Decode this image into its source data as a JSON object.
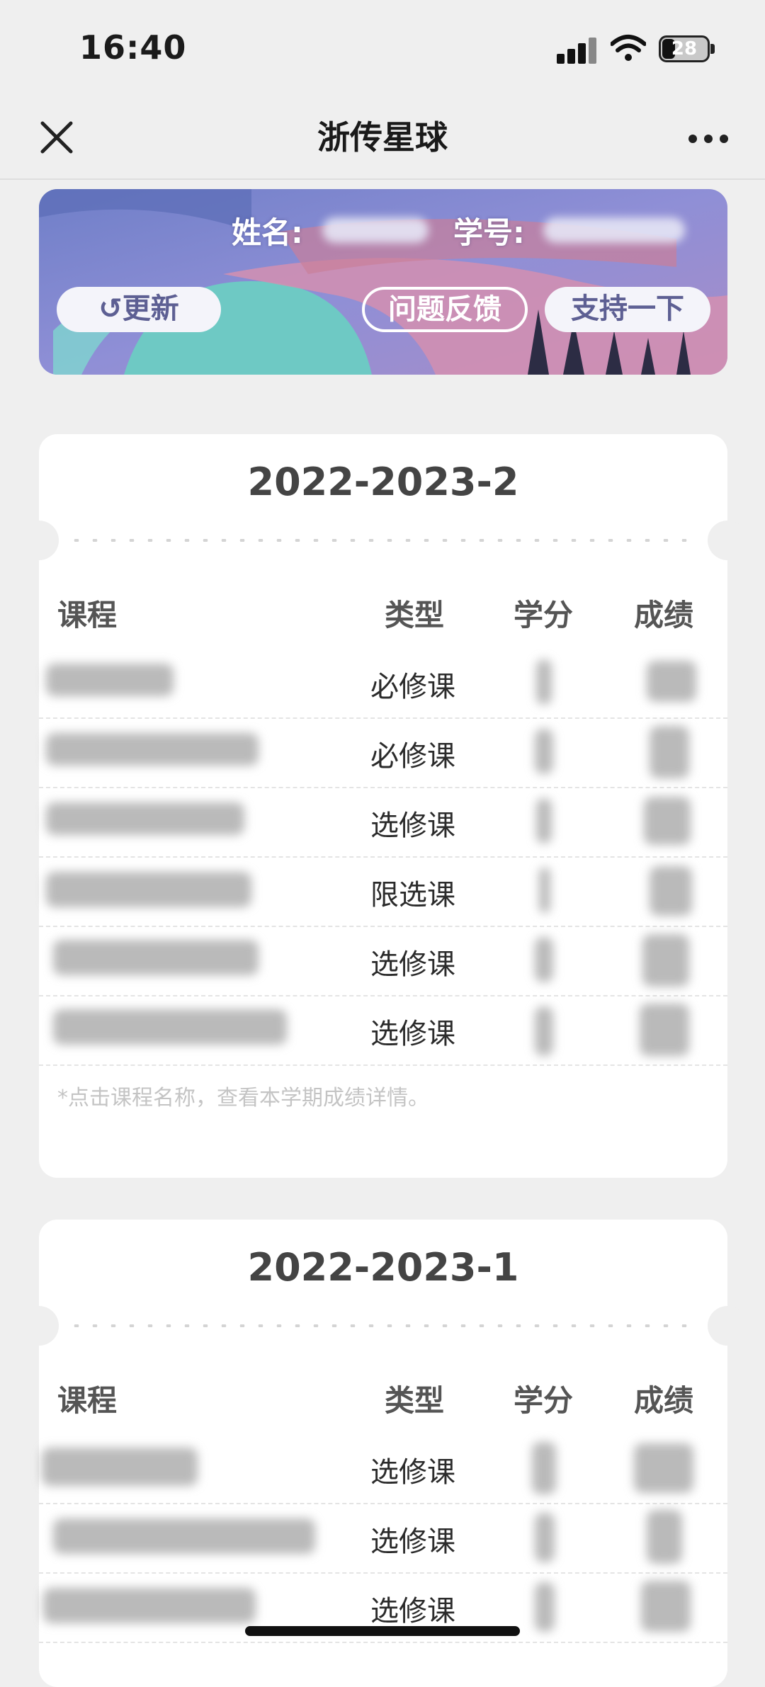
{
  "status_bar": {
    "time": "16:40",
    "battery": "28",
    "icons": [
      "signal-icon",
      "wifi-icon",
      "battery-icon"
    ]
  },
  "nav": {
    "title": "浙传星球",
    "close_icon": "close-icon",
    "more_icon": "more-dots-icon"
  },
  "banner": {
    "name_label": "姓名:",
    "id_label": "学号:",
    "refresh_icon": "refresh-icon",
    "refresh_label": "更新",
    "feedback_label": "问题反馈",
    "support_label": "支持一下"
  },
  "semesters": [
    {
      "term": "2022-2023-2",
      "headers": {
        "course": "课程",
        "type": "类型",
        "credit": "学分",
        "score": "成绩"
      },
      "rows": [
        {
          "type": "必修课"
        },
        {
          "type": "必修课"
        },
        {
          "type": "选修课"
        },
        {
          "type": "限选课"
        },
        {
          "type": "选修课"
        },
        {
          "type": "选修课"
        }
      ],
      "hint": "*点击课程名称，查看本学期成绩详情。"
    },
    {
      "term": "2022-2023-1",
      "headers": {
        "course": "课程",
        "type": "类型",
        "credit": "学分",
        "score": "成绩"
      },
      "rows": [
        {
          "type": "选修课"
        },
        {
          "type": "选修课"
        },
        {
          "type": "选修课"
        }
      ]
    }
  ],
  "colors": {
    "background": "#efefef",
    "card": "#ffffff",
    "banner_accent": "#5d5f93"
  }
}
